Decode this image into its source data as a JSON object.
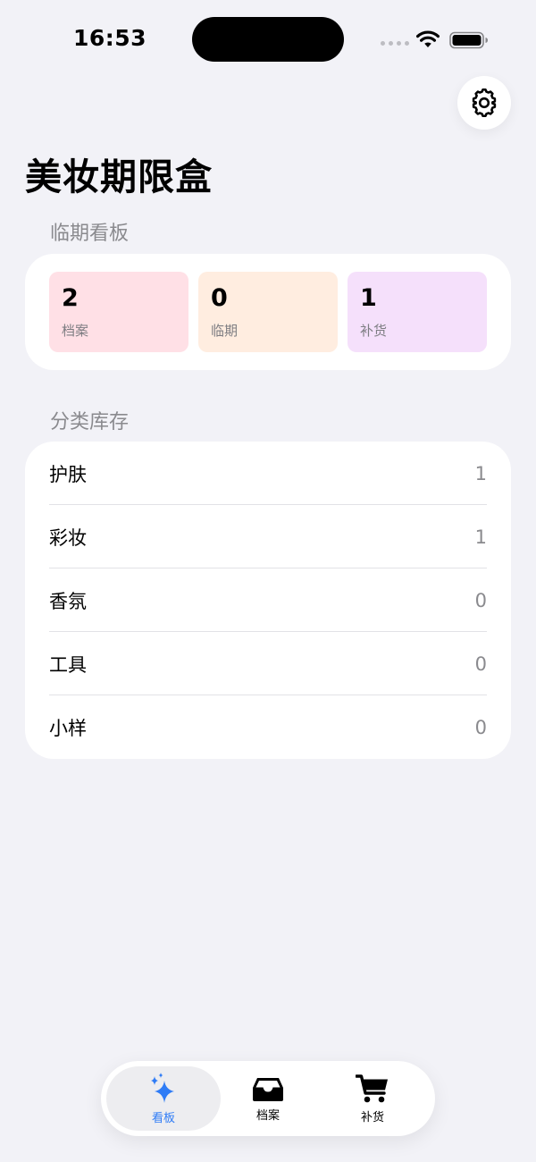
{
  "status_bar": {
    "time": "16:53"
  },
  "header": {
    "title": "美妆期限盒",
    "settings_icon": "gear-icon"
  },
  "dashboard": {
    "section_title": "临期看板",
    "stats": [
      {
        "value": "2",
        "label": "档案",
        "color": "#FFE0E6"
      },
      {
        "value": "0",
        "label": "临期",
        "color": "#FFEDE0"
      },
      {
        "value": "1",
        "label": "补货",
        "color": "#F5E0FB"
      }
    ]
  },
  "categories": {
    "section_title": "分类库存",
    "items": [
      {
        "name": "护肤",
        "count": "1"
      },
      {
        "name": "彩妆",
        "count": "1"
      },
      {
        "name": "香氛",
        "count": "0"
      },
      {
        "name": "工具",
        "count": "0"
      },
      {
        "name": "小样",
        "count": "0"
      }
    ]
  },
  "tab_bar": {
    "accent_color": "#2F7CF6",
    "tabs": [
      {
        "label": "看板",
        "icon": "sparkles-icon",
        "active": true
      },
      {
        "label": "档案",
        "icon": "tray-icon",
        "active": false
      },
      {
        "label": "补货",
        "icon": "cart-icon",
        "active": false
      }
    ]
  }
}
